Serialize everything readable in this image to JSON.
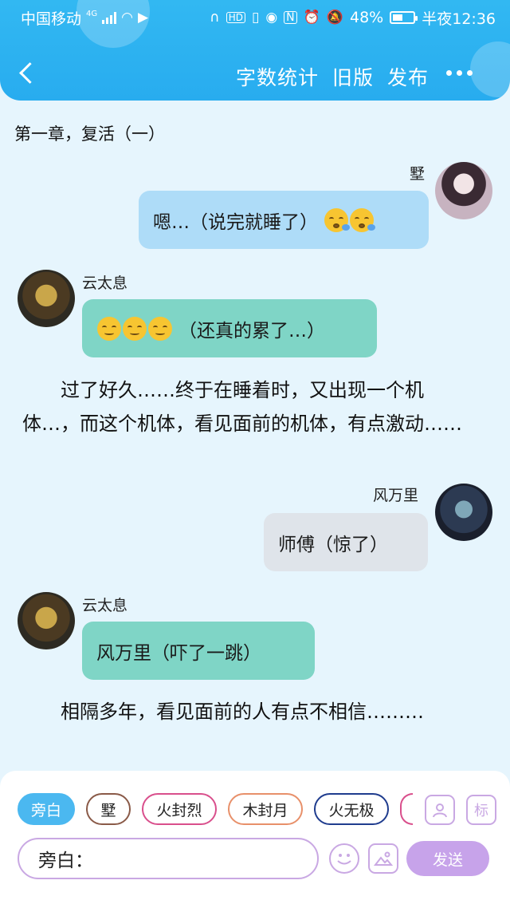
{
  "status_bar": {
    "carrier": "中国移动",
    "network": "4G",
    "battery": "48%",
    "time": "半夜12:36"
  },
  "nav": {
    "word_count": "字数统计",
    "old_version": "旧版",
    "publish": "发布"
  },
  "chapter_title": "第一章，复活（一）",
  "messages": [
    {
      "speaker": "墅",
      "text": "嗯…（说完就睡了）"
    },
    {
      "speaker": "云太息",
      "text": "（还真的累了…）"
    },
    {
      "narration": "过了好久……终于在睡着时，又出现一个机体…，而这个机体，看见面前的机体，有点激动……"
    },
    {
      "speaker": "风万里",
      "text": "师傅（惊了）"
    },
    {
      "speaker": "云太息",
      "text": "风万里（吓了一跳）"
    },
    {
      "narration": "相隔多年，看见面前的人有点不相信………"
    }
  ],
  "roles": [
    "旁白",
    "墅",
    "火封烈",
    "木封月",
    "火无极"
  ],
  "role_colors": [
    "#4bb8f0",
    "#8a5a48",
    "#d94f8c",
    "#e8906a",
    "#1f3c8e"
  ],
  "tools": {
    "avatar_label": "",
    "mark_label": "标"
  },
  "input": {
    "value": "旁白："
  },
  "send_label": "发送"
}
